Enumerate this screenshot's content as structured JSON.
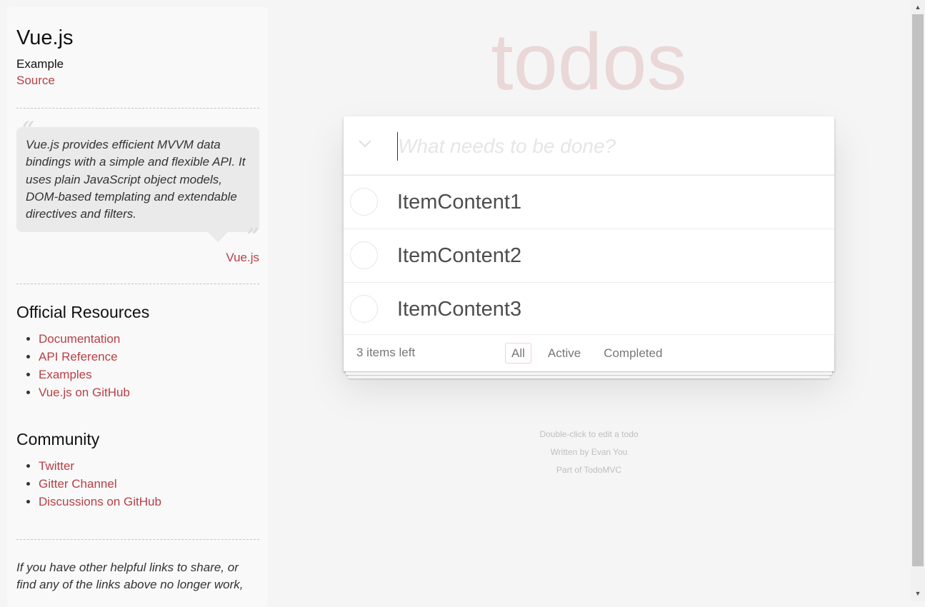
{
  "sidebar": {
    "title": "Vue.js",
    "subtitle": "Example",
    "source_label": "Source",
    "quote": "Vue.js provides efficient MVVM data bindings with a simple and flexible API. It uses plain JavaScript object models, DOM-based templating and extendable directives and filters.",
    "quote_author": "Vue.js",
    "official_resources": {
      "heading": "Official Resources",
      "items": [
        "Documentation",
        "API Reference",
        "Examples",
        "Vue.js on GitHub"
      ]
    },
    "community": {
      "heading": "Community",
      "items": [
        "Twitter",
        "Gitter Channel",
        "Discussions on GitHub"
      ]
    },
    "footer_note": "If you have other helpful links to share, or find any of the links above no longer work,"
  },
  "app": {
    "title": "todos",
    "new_todo_placeholder": "What needs to be done?",
    "new_todo_value": "",
    "toggle_all_icon": "chevron-down-icon",
    "todos": [
      {
        "label": "ItemContent1",
        "completed": false
      },
      {
        "label": "ItemContent2",
        "completed": false
      },
      {
        "label": "ItemContent3",
        "completed": false
      }
    ],
    "footer": {
      "count_text": "3 items left",
      "filters": [
        "All",
        "Active",
        "Completed"
      ],
      "selected_filter": "All"
    }
  },
  "info": {
    "line1": "Double-click to edit a todo",
    "line2": "Written by Evan You",
    "line3": "Part of TodoMVC"
  },
  "colors": {
    "accent": "#b83f45",
    "title": "#ead7d7",
    "background": "#f5f5f5"
  }
}
